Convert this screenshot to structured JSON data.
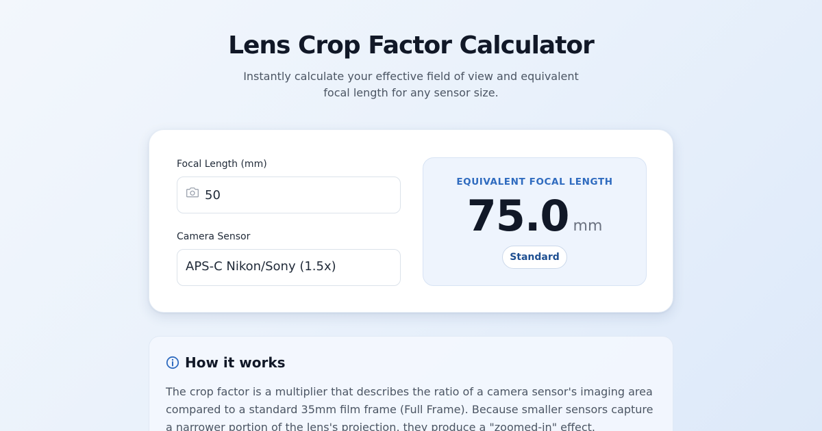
{
  "header": {
    "title": "Lens Crop Factor Calculator",
    "subtitle": "Instantly calculate your effective field of view and equivalent focal length for any sensor size."
  },
  "calculator": {
    "focal_length": {
      "label": "Focal Length (mm)",
      "value": "50",
      "icon": "camera-icon"
    },
    "sensor": {
      "label": "Camera Sensor",
      "selected": "APS-C Nikon/Sony (1.5x)"
    },
    "result": {
      "label": "EQUIVALENT FOCAL LENGTH",
      "value": "75.0",
      "unit": "mm",
      "badge": "Standard"
    }
  },
  "how_it_works": {
    "icon": "info-icon",
    "title": "How it works",
    "text": "The crop factor is a multiplier that describes the ratio of a camera sensor's imaging area compared to a standard 35mm film frame (Full Frame). Because smaller sensors capture a narrower portion of the lens's projection, they produce a \"zoomed-in\" effect."
  },
  "colors": {
    "accent": "#2f6bbf",
    "badge_text": "#1e4f91",
    "result_bg": "#eef4fd"
  }
}
